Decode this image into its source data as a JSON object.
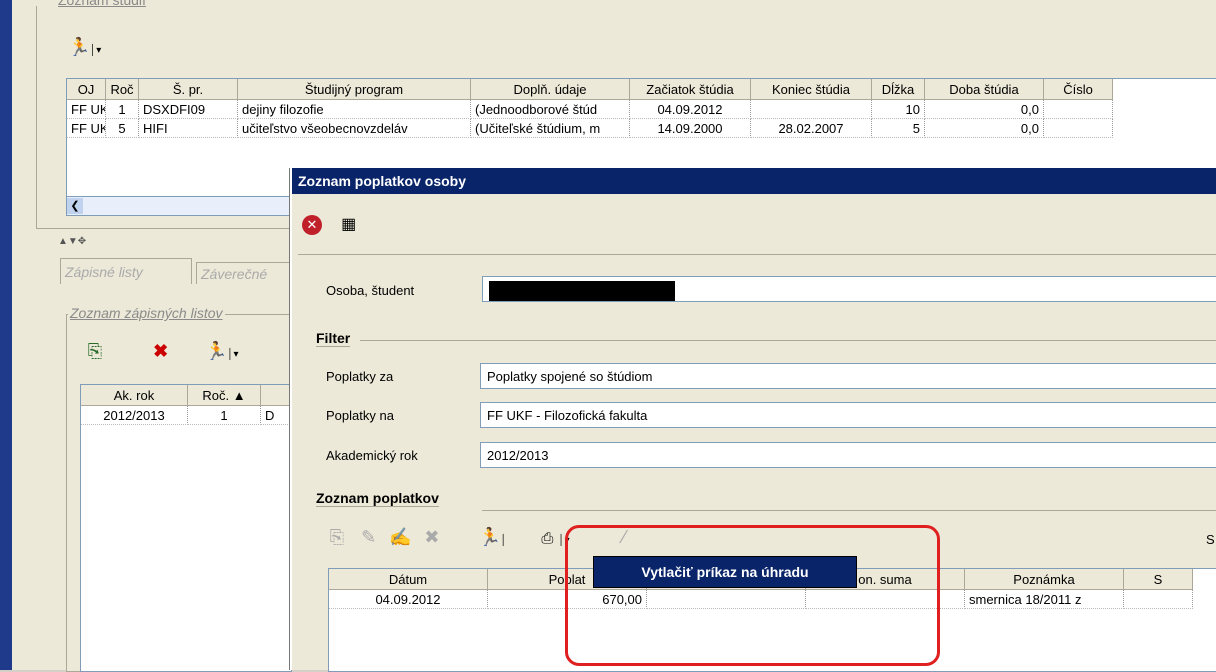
{
  "top_group": {
    "title": "Zoznam štúdií"
  },
  "studies_table": {
    "columns": [
      "OJ",
      "Roč",
      "Š. pr.",
      "Študijný program",
      "Doplň. údaje",
      "Začiatok štúdia",
      "Koniec štúdia",
      "Dĺžka",
      "Doba štúdia",
      "Číslo"
    ],
    "rows": [
      [
        "FF UKF",
        "1",
        "DSXDFI09",
        "dejiny filozofie",
        "(Jednoodborové štúd",
        "04.09.2012",
        "",
        "10",
        "0,0",
        ""
      ],
      [
        "FF UKF",
        "5",
        "HIFI",
        "učiteľstvo všeobecnovzdeláv",
        "(Učiteľské štúdium, m",
        "14.09.2000",
        "28.02.2007",
        "5",
        "0,0",
        ""
      ]
    ]
  },
  "tabs": [
    "Zápisné listy",
    "Záverečné"
  ],
  "enroll_group": {
    "title": "Zoznam zápisných listov"
  },
  "enroll_table": {
    "columns": [
      "Ak. rok",
      "Roč. ▲",
      ""
    ],
    "rows": [
      [
        "2012/2013",
        "1",
        "D"
      ]
    ]
  },
  "dialog": {
    "title": "Zoznam poplatkov osoby",
    "person_label": "Osoba, študent",
    "filter_title": "Filter",
    "fields": [
      {
        "label": "Poplatky za",
        "value": "Poplatky spojené so štúdiom"
      },
      {
        "label": "Poplatky na",
        "value": "FF UKF - Filozofická fakulta"
      },
      {
        "label": "Akademický rok",
        "value": "2012/2013"
      }
    ],
    "fees_title": "Zoznam poplatkov",
    "right_s": "S",
    "fees_table": {
      "columns": [
        "Dátum",
        "Poplat",
        "",
        "on. suma",
        "Poznámka",
        "S"
      ],
      "rows": [
        [
          "04.09.2012",
          "670,00",
          "",
          "",
          "smernica 18/2011 z",
          ""
        ]
      ]
    },
    "dropdown_item": "Vytlačiť príkaz na úhradu"
  },
  "icons": [
    "runner-icon",
    "dropdown-arrow-icon",
    "scroll-left-icon",
    "close-red-icon",
    "grid-settings-icon",
    "add-doc-icon",
    "delete-x-icon",
    "edit-pencil-icon",
    "sign-icon",
    "print-icon"
  ]
}
